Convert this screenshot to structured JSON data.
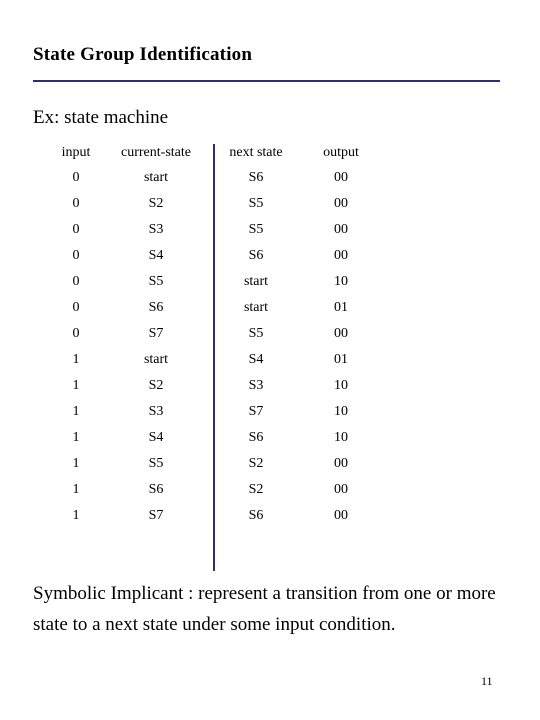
{
  "slide": {
    "title": "State Group Identification",
    "subtitle": "Ex: state machine",
    "paragraph": "Symbolic Implicant : represent a transition from one or more state to a next state under some input condition.",
    "page_number": "11",
    "accent_color": "#2b2f77"
  },
  "table": {
    "headers": [
      "input",
      "current-state",
      "next state",
      "output"
    ],
    "rows": [
      [
        "0",
        "start",
        "S6",
        "00"
      ],
      [
        "0",
        "S2",
        "S5",
        "00"
      ],
      [
        "0",
        "S3",
        "S5",
        "00"
      ],
      [
        "0",
        "S4",
        "S6",
        "00"
      ],
      [
        "0",
        "S5",
        "start",
        "10"
      ],
      [
        "0",
        "S6",
        "start",
        "01"
      ],
      [
        "0",
        "S7",
        "S5",
        "00"
      ],
      [
        "1",
        "start",
        "S4",
        "01"
      ],
      [
        "1",
        "S2",
        "S3",
        "10"
      ],
      [
        "1",
        "S3",
        "S7",
        "10"
      ],
      [
        "1",
        "S4",
        "S6",
        "10"
      ],
      [
        "1",
        "S5",
        "S2",
        "00"
      ],
      [
        "1",
        "S6",
        "S2",
        "00"
      ],
      [
        "1",
        "S7",
        "S6",
        "00"
      ]
    ]
  }
}
